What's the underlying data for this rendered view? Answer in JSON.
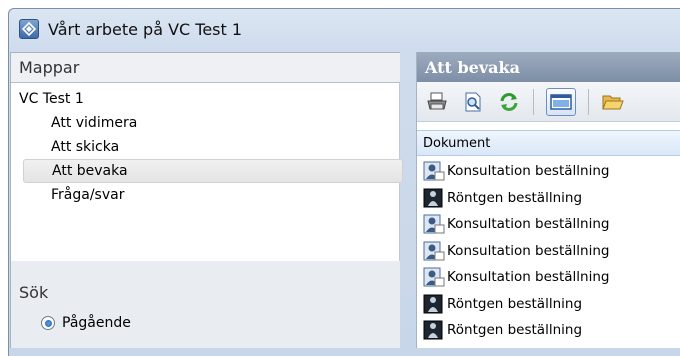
{
  "window": {
    "title": "Vårt arbete på VC Test 1",
    "icon": "app-diamond-icon"
  },
  "left": {
    "folders_header": "Mappar",
    "tree": {
      "root": "VC Test 1",
      "children": [
        {
          "label": "Att vidimera",
          "selected": false
        },
        {
          "label": "Att skicka",
          "selected": false
        },
        {
          "label": "Att bevaka",
          "selected": true
        },
        {
          "label": "Fråga/svar",
          "selected": false
        }
      ]
    },
    "search_header": "Sök",
    "radio": {
      "label": "Pågående",
      "checked": true
    }
  },
  "right": {
    "header": "Att bevaka",
    "toolbar": [
      "print-icon",
      "preview-icon",
      "refresh-icon",
      "view-pane-icon",
      "open-folder-icon"
    ],
    "column_header": "Dokument",
    "documents": [
      {
        "label": "Konsultation beställning",
        "icon": "consultation-doc-icon"
      },
      {
        "label": "Röntgen beställning",
        "icon": "xray-doc-icon"
      },
      {
        "label": "Konsultation beställning",
        "icon": "consultation-doc-icon"
      },
      {
        "label": "Konsultation beställning",
        "icon": "consultation-doc-icon"
      },
      {
        "label": "Konsultation beställning",
        "icon": "consultation-doc-icon"
      },
      {
        "label": "Röntgen beställning",
        "icon": "xray-doc-icon"
      },
      {
        "label": "Röntgen beställning",
        "icon": "xray-doc-icon"
      }
    ]
  },
  "colors": {
    "header_bar": "#8b9bb0",
    "selection": "#e6e6e6",
    "column_header": "#dce9f8"
  }
}
